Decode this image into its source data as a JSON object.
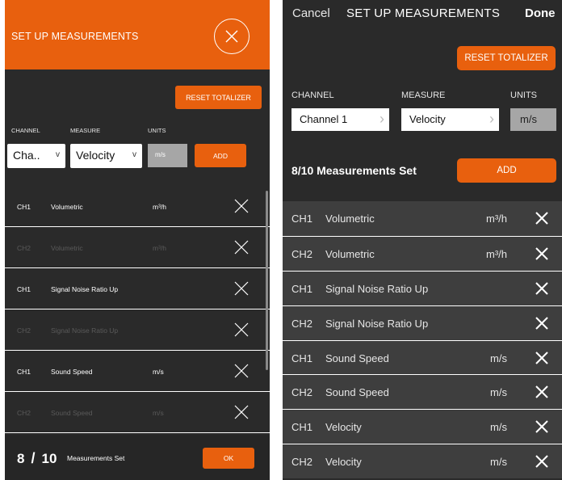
{
  "left": {
    "title": "SET UP MEASUREMENTS",
    "reset_label": "RESET TOTALIZER",
    "labels": {
      "channel": "CHANNEL",
      "measure": "MEASURE",
      "units": "UNITS"
    },
    "channel_value": "Cha..",
    "measure_value": "Velocity",
    "units_value": "m/s",
    "add_label": "ADD",
    "rows": [
      {
        "ch": "CH1",
        "measure": "Volumetric",
        "unit": "m³/h",
        "dim": false
      },
      {
        "ch": "CH2",
        "measure": "Volumetric",
        "unit": "m³/h",
        "dim": true
      },
      {
        "ch": "CH1",
        "measure": "Signal Noise Ratio Up",
        "unit": "",
        "dim": false
      },
      {
        "ch": "CH2",
        "measure": "Signal Noise Ratio Up",
        "unit": "",
        "dim": true
      },
      {
        "ch": "CH1",
        "measure": "Sound Speed",
        "unit": "m/s",
        "dim": false
      },
      {
        "ch": "CH2",
        "measure": "Sound Speed",
        "unit": "m/s",
        "dim": true
      }
    ],
    "footer": {
      "count": "8",
      "separator": "/",
      "total": "10",
      "label": "Measurements Set",
      "ok_label": "OK"
    }
  },
  "right": {
    "cancel_label": "Cancel",
    "title": "SET UP MEASUREMENTS",
    "done_label": "Done",
    "reset_label": "RESET TOTALIZER",
    "labels": {
      "channel": "CHANNEL",
      "measure": "MEASURE",
      "units": "UNITS"
    },
    "channel_value": "Channel 1",
    "measure_value": "Velocity",
    "units_value": "m/s",
    "count_text": "8/10 Measurements Set",
    "add_label": "ADD",
    "rows": [
      {
        "ch": "CH1",
        "measure": "Volumetric",
        "unit": "m³/h"
      },
      {
        "ch": "CH2",
        "measure": "Volumetric",
        "unit": "m³/h"
      },
      {
        "ch": "CH1",
        "measure": "Signal Noise Ratio Up",
        "unit": ""
      },
      {
        "ch": "CH2",
        "measure": "Signal Noise Ratio Up",
        "unit": ""
      },
      {
        "ch": "CH1",
        "measure": "Sound Speed",
        "unit": "m/s"
      },
      {
        "ch": "CH2",
        "measure": "Sound Speed",
        "unit": "m/s"
      },
      {
        "ch": "CH1",
        "measure": "Velocity",
        "unit": "m/s"
      },
      {
        "ch": "CH2",
        "measure": "Velocity",
        "unit": "m/s"
      }
    ]
  },
  "icons": {
    "close": "close-icon",
    "remove": "x-icon",
    "chevron": "chevron-right-icon",
    "dropdown": "chevron-down-icon"
  },
  "colors": {
    "accent": "#e8600e",
    "background": "#2a2a2a",
    "row": "#3e3e3e",
    "units_box": "#a6a6a6"
  }
}
